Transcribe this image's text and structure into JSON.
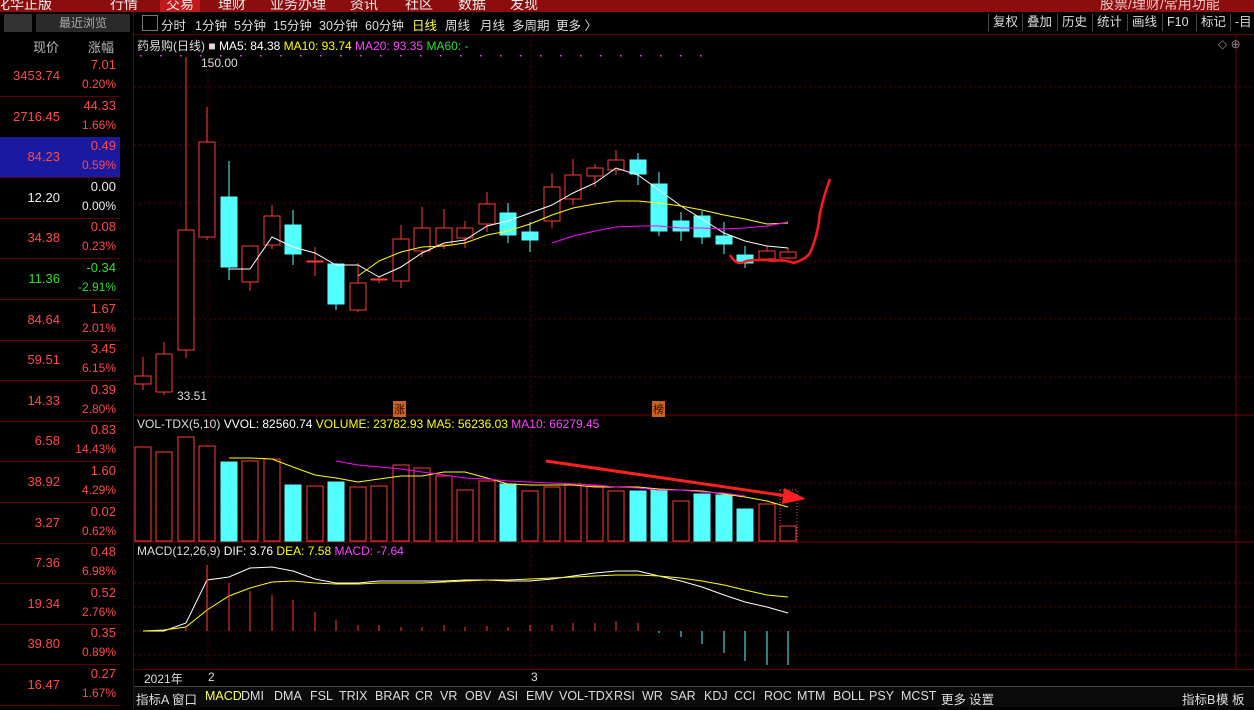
{
  "top_menu": {
    "items": [
      "行情",
      "交易",
      "理财",
      "业务办理",
      "资讯",
      "社区",
      "数据",
      "发现"
    ],
    "right_text": "股票/理财/常用功能"
  },
  "watchlist": {
    "tab_recent": "最近浏览",
    "col_price": "现价",
    "col_change": "涨幅",
    "rows": [
      {
        "price": "3453.74",
        "change": "7.01",
        "pct": "0.20%",
        "color": "#ff4a4a"
      },
      {
        "price": "2716.45",
        "change": "44.33",
        "pct": "1.66%",
        "color": "#ff4a4a"
      },
      {
        "price": "84.23",
        "change": "0.49",
        "pct": "0.59%",
        "color": "#ff4a4a"
      },
      {
        "price": "12.20",
        "change": "0.00",
        "pct": "0.00%",
        "color": "#eeeeee"
      },
      {
        "price": "34.38",
        "change": "0.08",
        "pct": "0.23%",
        "color": "#ff4a4a"
      },
      {
        "price": "11.36",
        "change": "-0.34",
        "pct": "-2.91%",
        "color": "#33dd33"
      },
      {
        "price": "84.64",
        "change": "1.67",
        "pct": "2.01%",
        "color": "#ff4a4a"
      },
      {
        "price": "59.51",
        "change": "3.45",
        "pct": "6.15%",
        "color": "#ff4a4a"
      },
      {
        "price": "14.33",
        "change": "0.39",
        "pct": "2.80%",
        "color": "#ff4a4a"
      },
      {
        "price": "6.58",
        "change": "0.83",
        "pct": "14.43%",
        "color": "#ff4a4a"
      },
      {
        "price": "38.92",
        "change": "1.60",
        "pct": "4.29%",
        "color": "#ff4a4a"
      },
      {
        "price": "3.27",
        "change": "0.02",
        "pct": "0.62%",
        "color": "#ff4a4a"
      },
      {
        "price": "7.36",
        "change": "0.48",
        "pct": "6.98%",
        "color": "#ff4a4a"
      },
      {
        "price": "19.34",
        "change": "0.52",
        "pct": "2.76%",
        "color": "#ff4a4a"
      },
      {
        "price": "39.80",
        "change": "0.35",
        "pct": "0.89%",
        "color": "#ff4a4a"
      },
      {
        "price": "16.47",
        "change": "0.27",
        "pct": "1.67%",
        "color": "#ff4a4a"
      }
    ]
  },
  "period_bar": {
    "items": [
      "分时",
      "1分钟",
      "5分钟",
      "15分钟",
      "30分钟",
      "60分钟",
      "日线",
      "周线",
      "月线",
      "多周期",
      "更多 〉"
    ],
    "active": "日线",
    "right_buttons": [
      "复权",
      "叠加",
      "历史",
      "统计",
      "画线",
      "F10",
      "标记",
      "-目"
    ]
  },
  "kline": {
    "name": "药易购(日线)",
    "ma5_label": "MA5: 84.38",
    "ma10_label": "MA10: 93.74",
    "ma20_label": "MA20: 93.35",
    "ma60_label": "MA60: -",
    "high_label": "150.00",
    "low_label": "33.51",
    "marker_zhang": "涨",
    "marker_bang": "榜",
    "colors": {
      "up": "#ff3b3b",
      "down": "#54ffff",
      "ma5": "#ffffff",
      "ma10": "#ffff00",
      "ma20": "#ff00ff"
    }
  },
  "volume": {
    "name": "VOL-TDX(5,10)",
    "vvol_label": "VVOL: 82560.74",
    "volume_label": "VOLUME: 23782.93",
    "ma5_label": "MA5: 56236.03",
    "ma10_label": "MA10: 66279.45"
  },
  "macd": {
    "name": "MACD(12,26,9)",
    "dif_label": "DIF: 3.76",
    "dea_label": "DEA: 7.58",
    "macd_label": "MACD: -7.64"
  },
  "date_axis": {
    "year_label": "2021年",
    "month_2": "2",
    "month_3": "3"
  },
  "bottom_tabs": {
    "items": [
      "指标A",
      "窗口",
      "MACD",
      "DMI",
      "DMA",
      "FSL",
      "TRIX",
      "BRAR",
      "CR",
      "VR",
      "OBV",
      "ASI",
      "EMV",
      "VOL-TDX",
      "RSI",
      "WR",
      "SAR",
      "KDJ",
      "CCI",
      "ROC",
      "MTM",
      "BOLL",
      "PSY",
      "MCST",
      "更多",
      "设置"
    ],
    "active": "MACD",
    "right": [
      "指标B",
      "模",
      "板"
    ]
  }
}
